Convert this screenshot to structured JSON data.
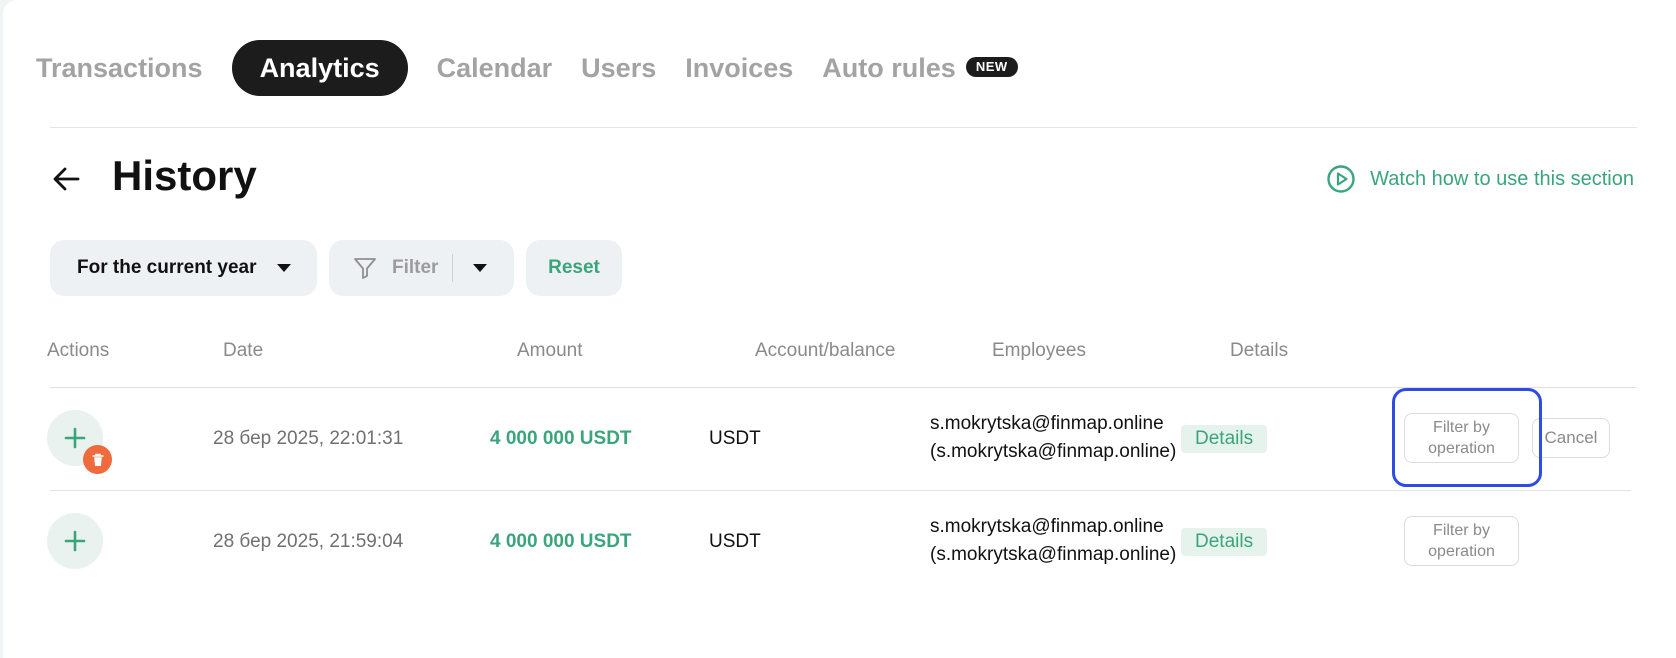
{
  "tabs": [
    {
      "label": "Transactions",
      "active": false
    },
    {
      "label": "Analytics",
      "active": true
    },
    {
      "label": "Calendar",
      "active": false
    },
    {
      "label": "Users",
      "active": false
    },
    {
      "label": "Invoices",
      "active": false
    },
    {
      "label": "Auto rules",
      "active": false,
      "badge": "NEW"
    }
  ],
  "header": {
    "title": "History",
    "watch_label": "Watch how to use this section"
  },
  "filters": {
    "period_label": "For the current year",
    "filter_label": "Filter",
    "reset_label": "Reset"
  },
  "table": {
    "columns": [
      "Actions",
      "Date",
      "Amount",
      "Account/balance",
      "Employees",
      "Details"
    ],
    "rows": [
      {
        "date": "28 бер 2025, 22:01:31",
        "amount": "4 000 000 USDT",
        "account": "USDT",
        "employee_email": "s.mokrytska@finmap.online",
        "employee_name": "(s.mokrytska@finmap.online)",
        "details_label": "Details",
        "filter_op_line1": "Filter by",
        "filter_op_line2": "operation",
        "cancel_label": "Cancel",
        "deleted": true
      },
      {
        "date": "28 бер 2025, 21:59:04",
        "amount": "4 000 000 USDT",
        "account": "USDT",
        "employee_email": "s.mokrytska@finmap.online",
        "employee_name": "(s.mokrytska@finmap.online)",
        "details_label": "Details",
        "filter_op_line1": "Filter by",
        "filter_op_line2": "operation",
        "deleted": false
      }
    ]
  },
  "colors": {
    "accent_green": "#3aa57a",
    "dark": "#1c1c1c",
    "delete_orange": "#ef6a3c",
    "highlight_blue": "#2d4ce6"
  },
  "icons": [
    "arrow-left-icon",
    "play-circle-icon",
    "chevron-down-icon",
    "funnel-icon",
    "plus-icon",
    "trash-icon"
  ]
}
